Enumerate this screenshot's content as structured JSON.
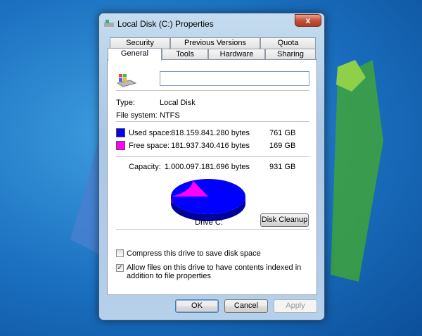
{
  "window": {
    "title": "Local Disk (C:) Properties",
    "close": "x"
  },
  "tabs_row1": [
    "Security",
    "Previous Versions",
    "Quota"
  ],
  "tabs_row2": [
    "General",
    "Tools",
    "Hardware",
    "Sharing"
  ],
  "general": {
    "name_value": "",
    "type_label": "Type:",
    "type_value": "Local Disk",
    "fs_label": "File system:",
    "fs_value": "NTFS",
    "used": {
      "label": "Used space:",
      "bytes": "818.159.841.280 bytes",
      "size": "761 GB",
      "color": "#0000ff"
    },
    "free": {
      "label": "Free space:",
      "bytes": "181.937.340.416 bytes",
      "size": "169 GB",
      "color": "#ff00ff"
    },
    "capacity": {
      "label": "Capacity:",
      "bytes": "1.000.097.181.696 bytes",
      "size": "931 GB"
    },
    "used_fraction": 0.818,
    "drive_label": "Drive C:",
    "disk_cleanup": "Disk Cleanup",
    "compress": {
      "label": "Compress this drive to save disk space",
      "checked": false
    },
    "index": {
      "label": "Allow files on this drive to have contents indexed in addition to file properties",
      "checked": true,
      "mark": "✓"
    }
  },
  "buttons": {
    "ok": "OK",
    "cancel": "Cancel",
    "apply": "Apply"
  }
}
